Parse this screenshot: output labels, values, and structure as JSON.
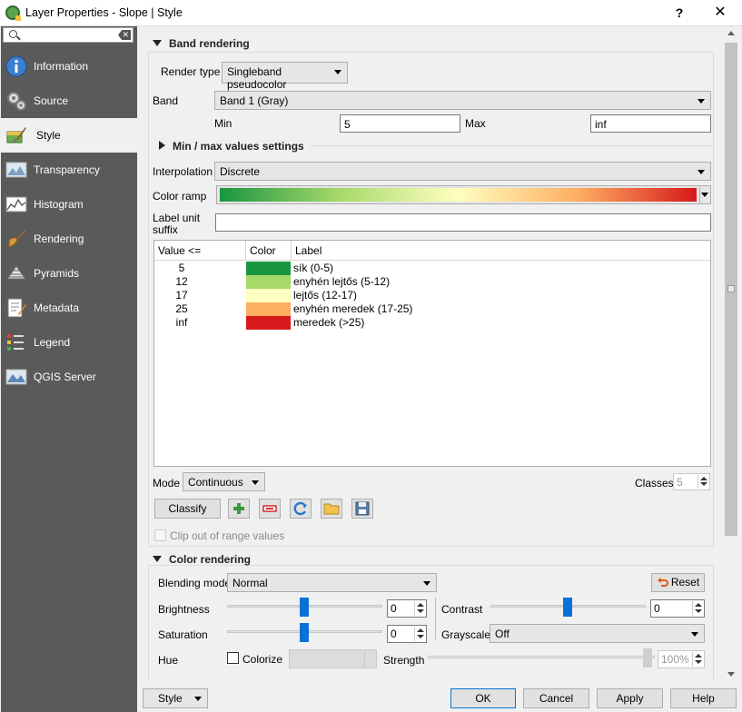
{
  "window": {
    "title": "Layer Properties - Slope | Style",
    "help": "?",
    "close": "✕"
  },
  "sidebar": {
    "search_placeholder": "",
    "items": [
      {
        "label": "Information",
        "icon": "info-icon"
      },
      {
        "label": "Source",
        "icon": "source-icon"
      },
      {
        "label": "Style",
        "icon": "style-icon",
        "active": true
      },
      {
        "label": "Transparency",
        "icon": "transparency-icon"
      },
      {
        "label": "Histogram",
        "icon": "histogram-icon"
      },
      {
        "label": "Rendering",
        "icon": "rendering-icon"
      },
      {
        "label": "Pyramids",
        "icon": "pyramids-icon"
      },
      {
        "label": "Metadata",
        "icon": "metadata-icon"
      },
      {
        "label": "Legend",
        "icon": "legend-icon"
      },
      {
        "label": "QGIS Server",
        "icon": "qgis-server-icon"
      }
    ]
  },
  "band_rendering": {
    "header": "Band rendering",
    "render_type_label": "Render type",
    "render_type": "Singleband pseudocolor",
    "band_label": "Band",
    "band": "Band 1 (Gray)",
    "min_label": "Min",
    "min": "5",
    "max_label": "Max",
    "max": "inf",
    "minmax_header": "Min / max values settings",
    "interpolation_label": "Interpolation",
    "interpolation": "Discrete",
    "color_ramp_label": "Color ramp",
    "label_unit_suffix_label_1": "Label unit",
    "label_unit_suffix_label_2": "suffix",
    "label_unit_suffix": "",
    "table": {
      "headers": [
        "Value <=",
        "Color",
        "Label"
      ],
      "rows": [
        {
          "value": "5",
          "color": "#1a9641",
          "label": "sík (0-5)"
        },
        {
          "value": "12",
          "color": "#a6d96a",
          "label": "enyhén lejtős (5-12)"
        },
        {
          "value": "17",
          "color": "#ffffc0",
          "label": "lejtős (12-17)"
        },
        {
          "value": "25",
          "color": "#fdae61",
          "label": "enyhén meredek (17-25)"
        },
        {
          "value": "inf",
          "color": "#d7191c",
          "label": "meredek (>25)"
        }
      ]
    },
    "mode_label": "Mode",
    "mode": "Continuous",
    "classes_label": "Classes",
    "classes": "5",
    "classify_label": "Classify",
    "clip_label": "Clip out of range values"
  },
  "color_rendering": {
    "header": "Color rendering",
    "blending_label": "Blending mode",
    "blending": "Normal",
    "reset_label": "Reset",
    "brightness_label": "Brightness",
    "brightness": "0",
    "contrast_label": "Contrast",
    "contrast": "0",
    "saturation_label": "Saturation",
    "saturation": "0",
    "grayscale_label": "Grayscale",
    "grayscale": "Off",
    "hue_label": "Hue",
    "colorize_label": "Colorize",
    "strength_label": "Strength",
    "strength": "100%"
  },
  "footer": {
    "style_label": "Style",
    "ok_label": "OK",
    "cancel_label": "Cancel",
    "apply_label": "Apply",
    "help_label": "Help"
  },
  "colors": {
    "accent": "#0a72d6",
    "sidebar_bg": "#5a5a5a"
  }
}
